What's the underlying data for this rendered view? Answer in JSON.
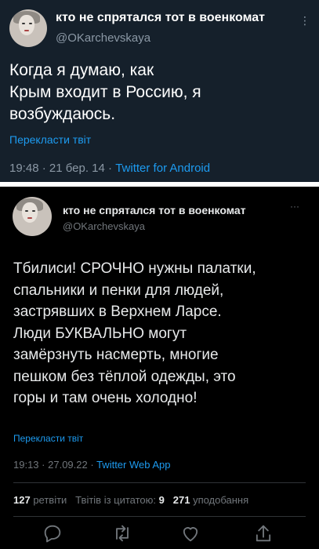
{
  "tweet1": {
    "display_name": "кто не спрятался тот в военкомат",
    "handle": "@OKarchevskaya",
    "body": "Когда я думаю, как\nКрым входит в Россию, я\nвозбуждаюсь.",
    "translate_label": "Перекласти твіт",
    "time": "19:48",
    "date": "21 бер. 14",
    "source": "Twitter for Android",
    "more_icon": "⋮"
  },
  "tweet2": {
    "display_name": "кто не спрятался тот в военкомат",
    "handle": "@OKarchevskaya",
    "body": "Тбилиси! СРОЧНО нужны палатки,\nспальники и пенки для людей,\nзастрявших в Верхнем Ларсе.\nЛюди БУКВАЛЬНО могут\nзамёрзнуть насмерть, многие\nпешком без тёплой одежды, это\nгоры и там очень холодно!",
    "translate_label": "Перекласти твіт",
    "time": "19:13",
    "date": "27.09.22",
    "source": "Twitter Web App",
    "more_icon": "···",
    "stats": {
      "retweets_count": "127",
      "retweets_label": "ретвіти",
      "quotes_label": "Твітів із цитатою:",
      "quotes_count": "9",
      "likes_count": "271",
      "likes_label": "уподобання"
    },
    "actions": [
      "reply-icon",
      "retweet-icon",
      "like-icon",
      "share-icon"
    ]
  },
  "colors": {
    "dim_bg": "#15202b",
    "black_bg": "#000000",
    "accent": "#1d9bf0",
    "muted": "#71767b"
  }
}
